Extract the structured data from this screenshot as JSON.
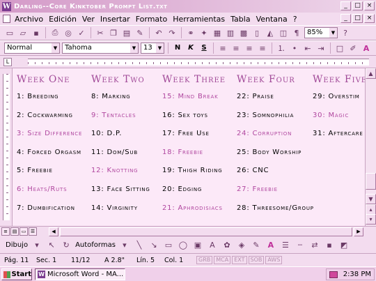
{
  "window": {
    "title": "Darling--Core Kinktober Prompt List.txt",
    "controls": [
      "_",
      "□",
      "×"
    ]
  },
  "menu": {
    "items": [
      "Archivo",
      "Edición",
      "Ver",
      "Insertar",
      "Formato",
      "Herramientas",
      "Tabla",
      "Ventana",
      "?"
    ]
  },
  "toolbar": {
    "zoom": "85%"
  },
  "format_bar": {
    "style": "Normal",
    "font": "Tahoma",
    "size": "13",
    "bold": "N",
    "italic": "K",
    "underline": "S"
  },
  "document": {
    "weeks": [
      {
        "heading": "Week One",
        "prompts": [
          {
            "text": "1: Breeding",
            "highlight": false
          },
          {
            "text": "2: Cockwarming",
            "highlight": false
          },
          {
            "text": "3: Size Difference",
            "highlight": true
          },
          {
            "text": "4: Forced Orgasm",
            "highlight": false
          },
          {
            "text": "5: Freebie",
            "highlight": false
          },
          {
            "text": "6: Heats/Ruts",
            "highlight": true
          },
          {
            "text": "7: Dumbification",
            "highlight": false
          }
        ]
      },
      {
        "heading": "Week Two",
        "prompts": [
          {
            "text": "8: Marking",
            "highlight": false
          },
          {
            "text": "9: Tentacles",
            "highlight": true
          },
          {
            "text": "10: D.P.",
            "highlight": false
          },
          {
            "text": "11: Dom/Sub",
            "highlight": false
          },
          {
            "text": "12: Knotting",
            "highlight": true
          },
          {
            "text": "13: Face Sitting",
            "highlight": false
          },
          {
            "text": "14: Virginity",
            "highlight": false
          }
        ]
      },
      {
        "heading": "Week Three",
        "prompts": [
          {
            "text": "15: Mind Break",
            "highlight": true
          },
          {
            "text": "16: Sex toys",
            "highlight": false
          },
          {
            "text": "17: Free Use",
            "highlight": false
          },
          {
            "text": "18: Freebie",
            "highlight": true
          },
          {
            "text": "19: Thigh Riding",
            "highlight": false
          },
          {
            "text": "20: Edging",
            "highlight": false
          },
          {
            "text": "21: Aphrodisiacs",
            "highlight": true
          }
        ]
      },
      {
        "heading": "Week Four",
        "prompts": [
          {
            "text": "22: Praise",
            "highlight": false
          },
          {
            "text": "23: Somnophilia",
            "highlight": false
          },
          {
            "text": "24: Corruption",
            "highlight": true
          },
          {
            "text": "25: Body Worship",
            "highlight": false
          },
          {
            "text": "26: CNC",
            "highlight": false
          },
          {
            "text": "27: Freebie",
            "highlight": true
          },
          {
            "text": "28: Threesome/Group",
            "highlight": false
          }
        ]
      },
      {
        "heading": "Week Five",
        "prompts": [
          {
            "text": "29: Overstim",
            "highlight": false
          },
          {
            "text": "30: Magic",
            "highlight": true
          },
          {
            "text": "31: Aftercare",
            "highlight": false
          }
        ]
      }
    ]
  },
  "draw_bar": {
    "draw_label": "Dibujo",
    "autoshapes_label": "Autoformas"
  },
  "status": {
    "page": "Pág. 11",
    "section": "Sec. 1",
    "of": "11/12",
    "at": "A 2.8\"",
    "line": "Lín. 5",
    "col": "Col. 1",
    "indicators": [
      "GRB",
      "MCA",
      "EXT",
      "SOB",
      "AWS"
    ]
  },
  "taskbar": {
    "start_label": "Start",
    "task_label": "Microsoft Word - MA...",
    "clock": "2:38 PM"
  },
  "colors": {
    "heading": "#a14a98",
    "highlight_text": "#b0479f",
    "page_bg": "#fce9f8",
    "chrome": "#f3dcef"
  }
}
